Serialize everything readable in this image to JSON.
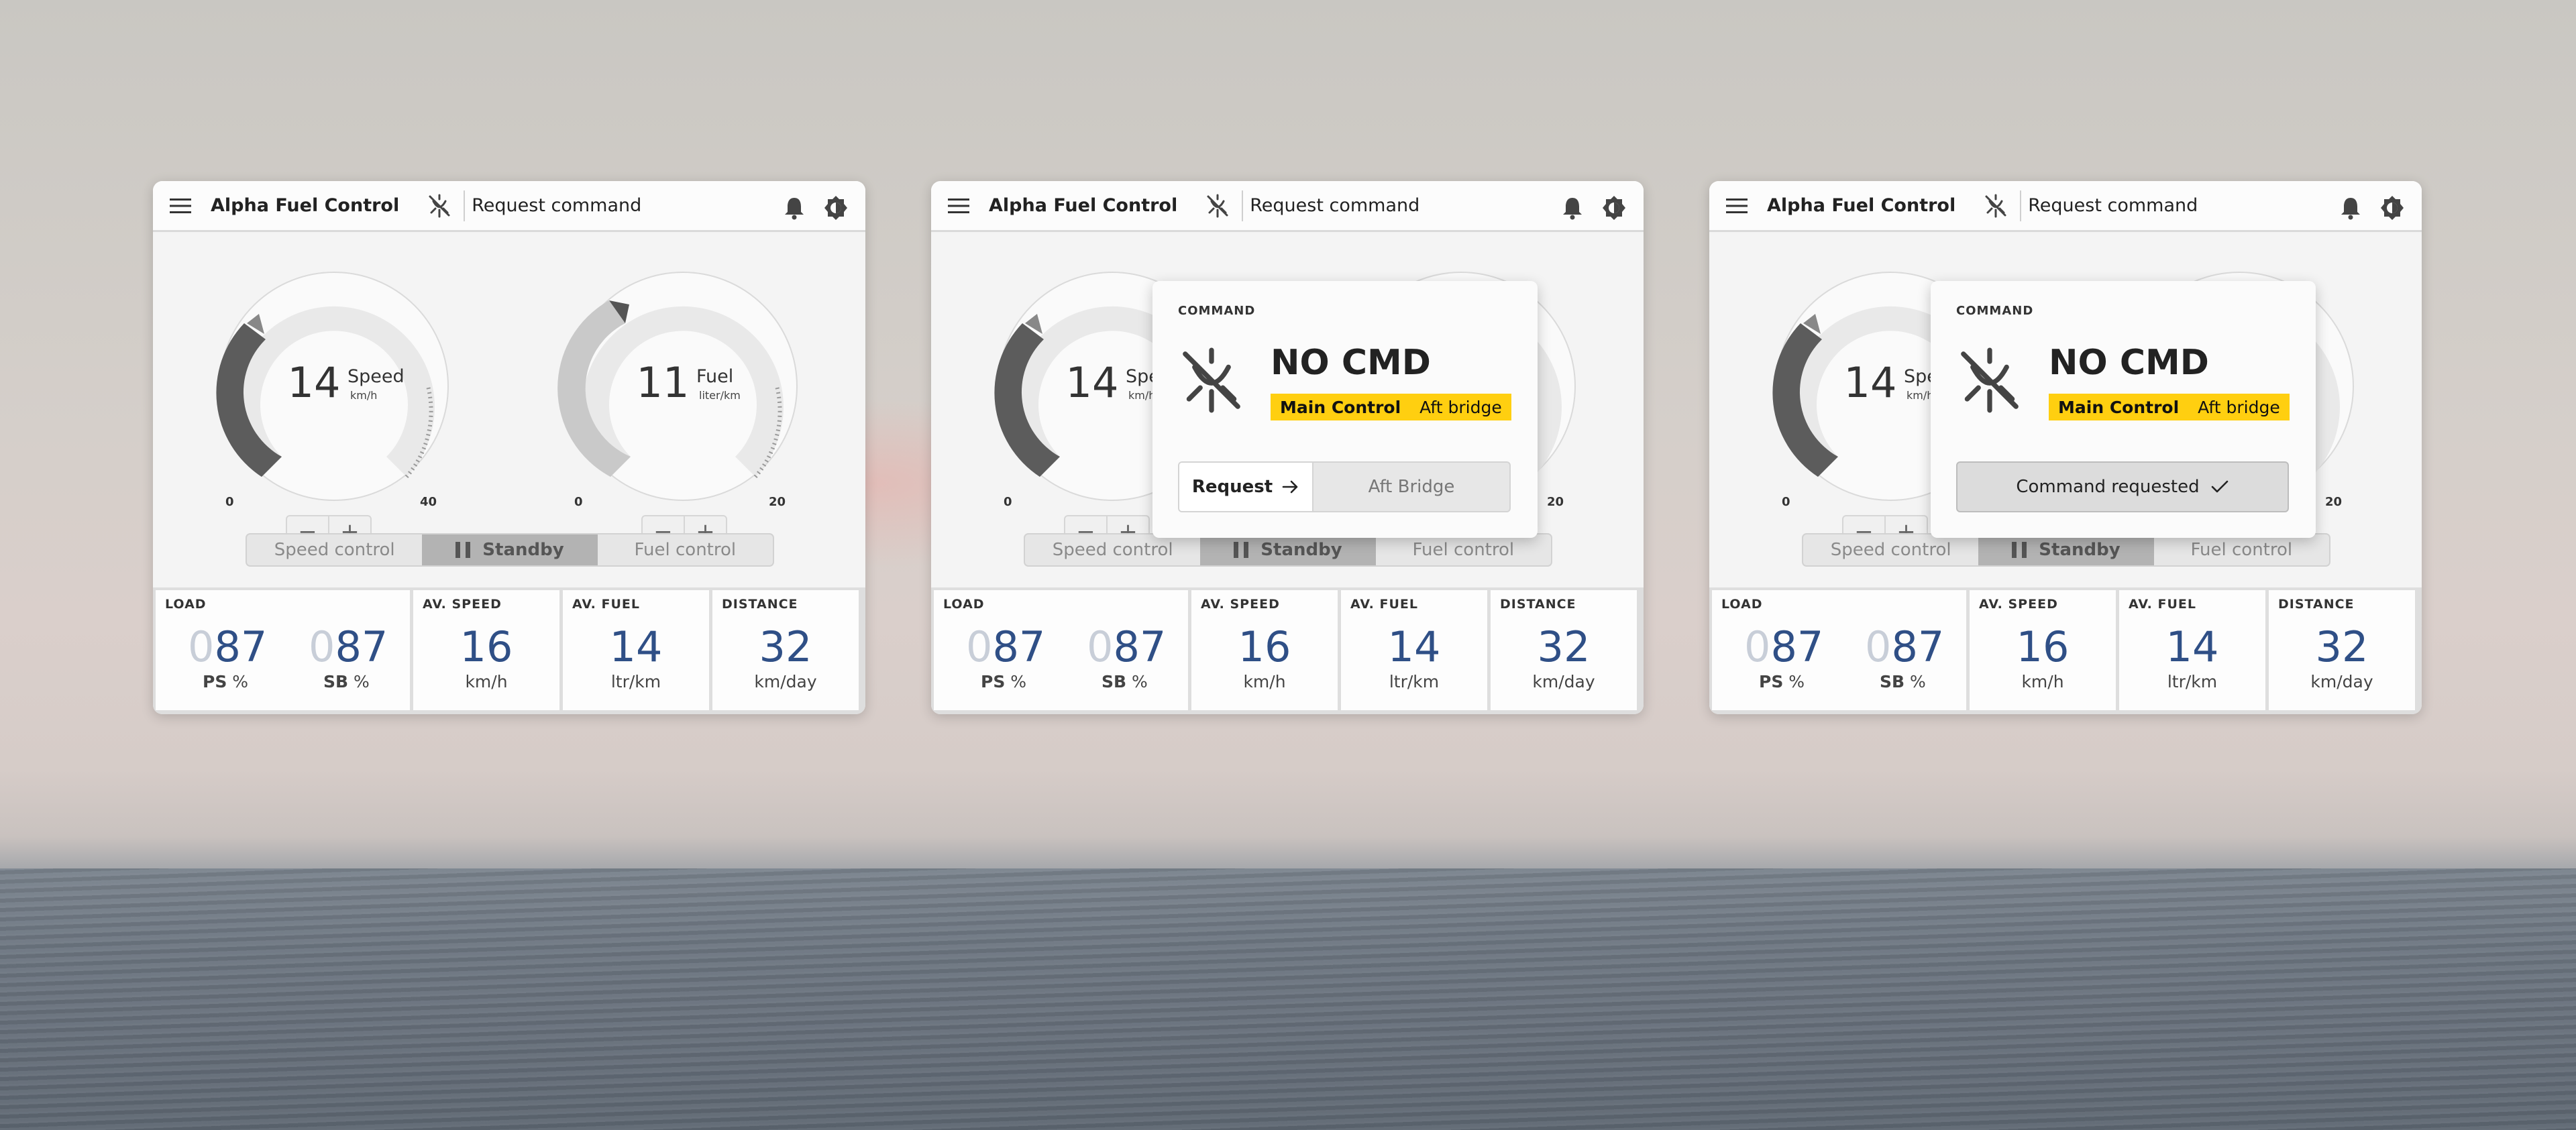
{
  "app": {
    "title": "Alpha Fuel Control",
    "request_label": "Request command"
  },
  "gauges": {
    "speed": {
      "value": "14",
      "label": "Speed",
      "unit": "km/h",
      "min": "0",
      "max": "40",
      "level": 0.35
    },
    "fuel": {
      "value": "11",
      "label": "Fuel",
      "unit": "liter/km",
      "min": "0",
      "max": "20",
      "level": 0.55
    }
  },
  "stepper": {
    "minus": "−",
    "plus": "+"
  },
  "modes": {
    "speed": "Speed control",
    "standby": "Standby",
    "fuel": "Fuel control",
    "active": "standby"
  },
  "stats": {
    "load": {
      "label": "LOAD",
      "ps_ghost": "0",
      "ps_value": "87",
      "ps_side": "PS",
      "ps_unit": "%",
      "sb_ghost": "0",
      "sb_value": "87",
      "sb_side": "SB",
      "sb_unit": "%"
    },
    "speed": {
      "label": "AV. SPEED",
      "value": "16",
      "unit": "km/h"
    },
    "fuel": {
      "label": "AV. FUEL",
      "value": "14",
      "unit": "ltr/km"
    },
    "distance": {
      "label": "DISTANCE",
      "value": "32",
      "unit": "km/day"
    }
  },
  "popup": {
    "title": "COMMAND",
    "status": "NO CMD",
    "tag_main": "Main Control",
    "tag_location": "Aft bridge",
    "request_button": "Request",
    "alt_location": "Aft Bridge",
    "requested_label": "Command requested"
  },
  "colors": {
    "accent_blue": "#2f4f86",
    "tag_yellow": "#ffcf10",
    "dial_dark": "#5c5c5c",
    "dial_light": "#c9c9c9"
  }
}
